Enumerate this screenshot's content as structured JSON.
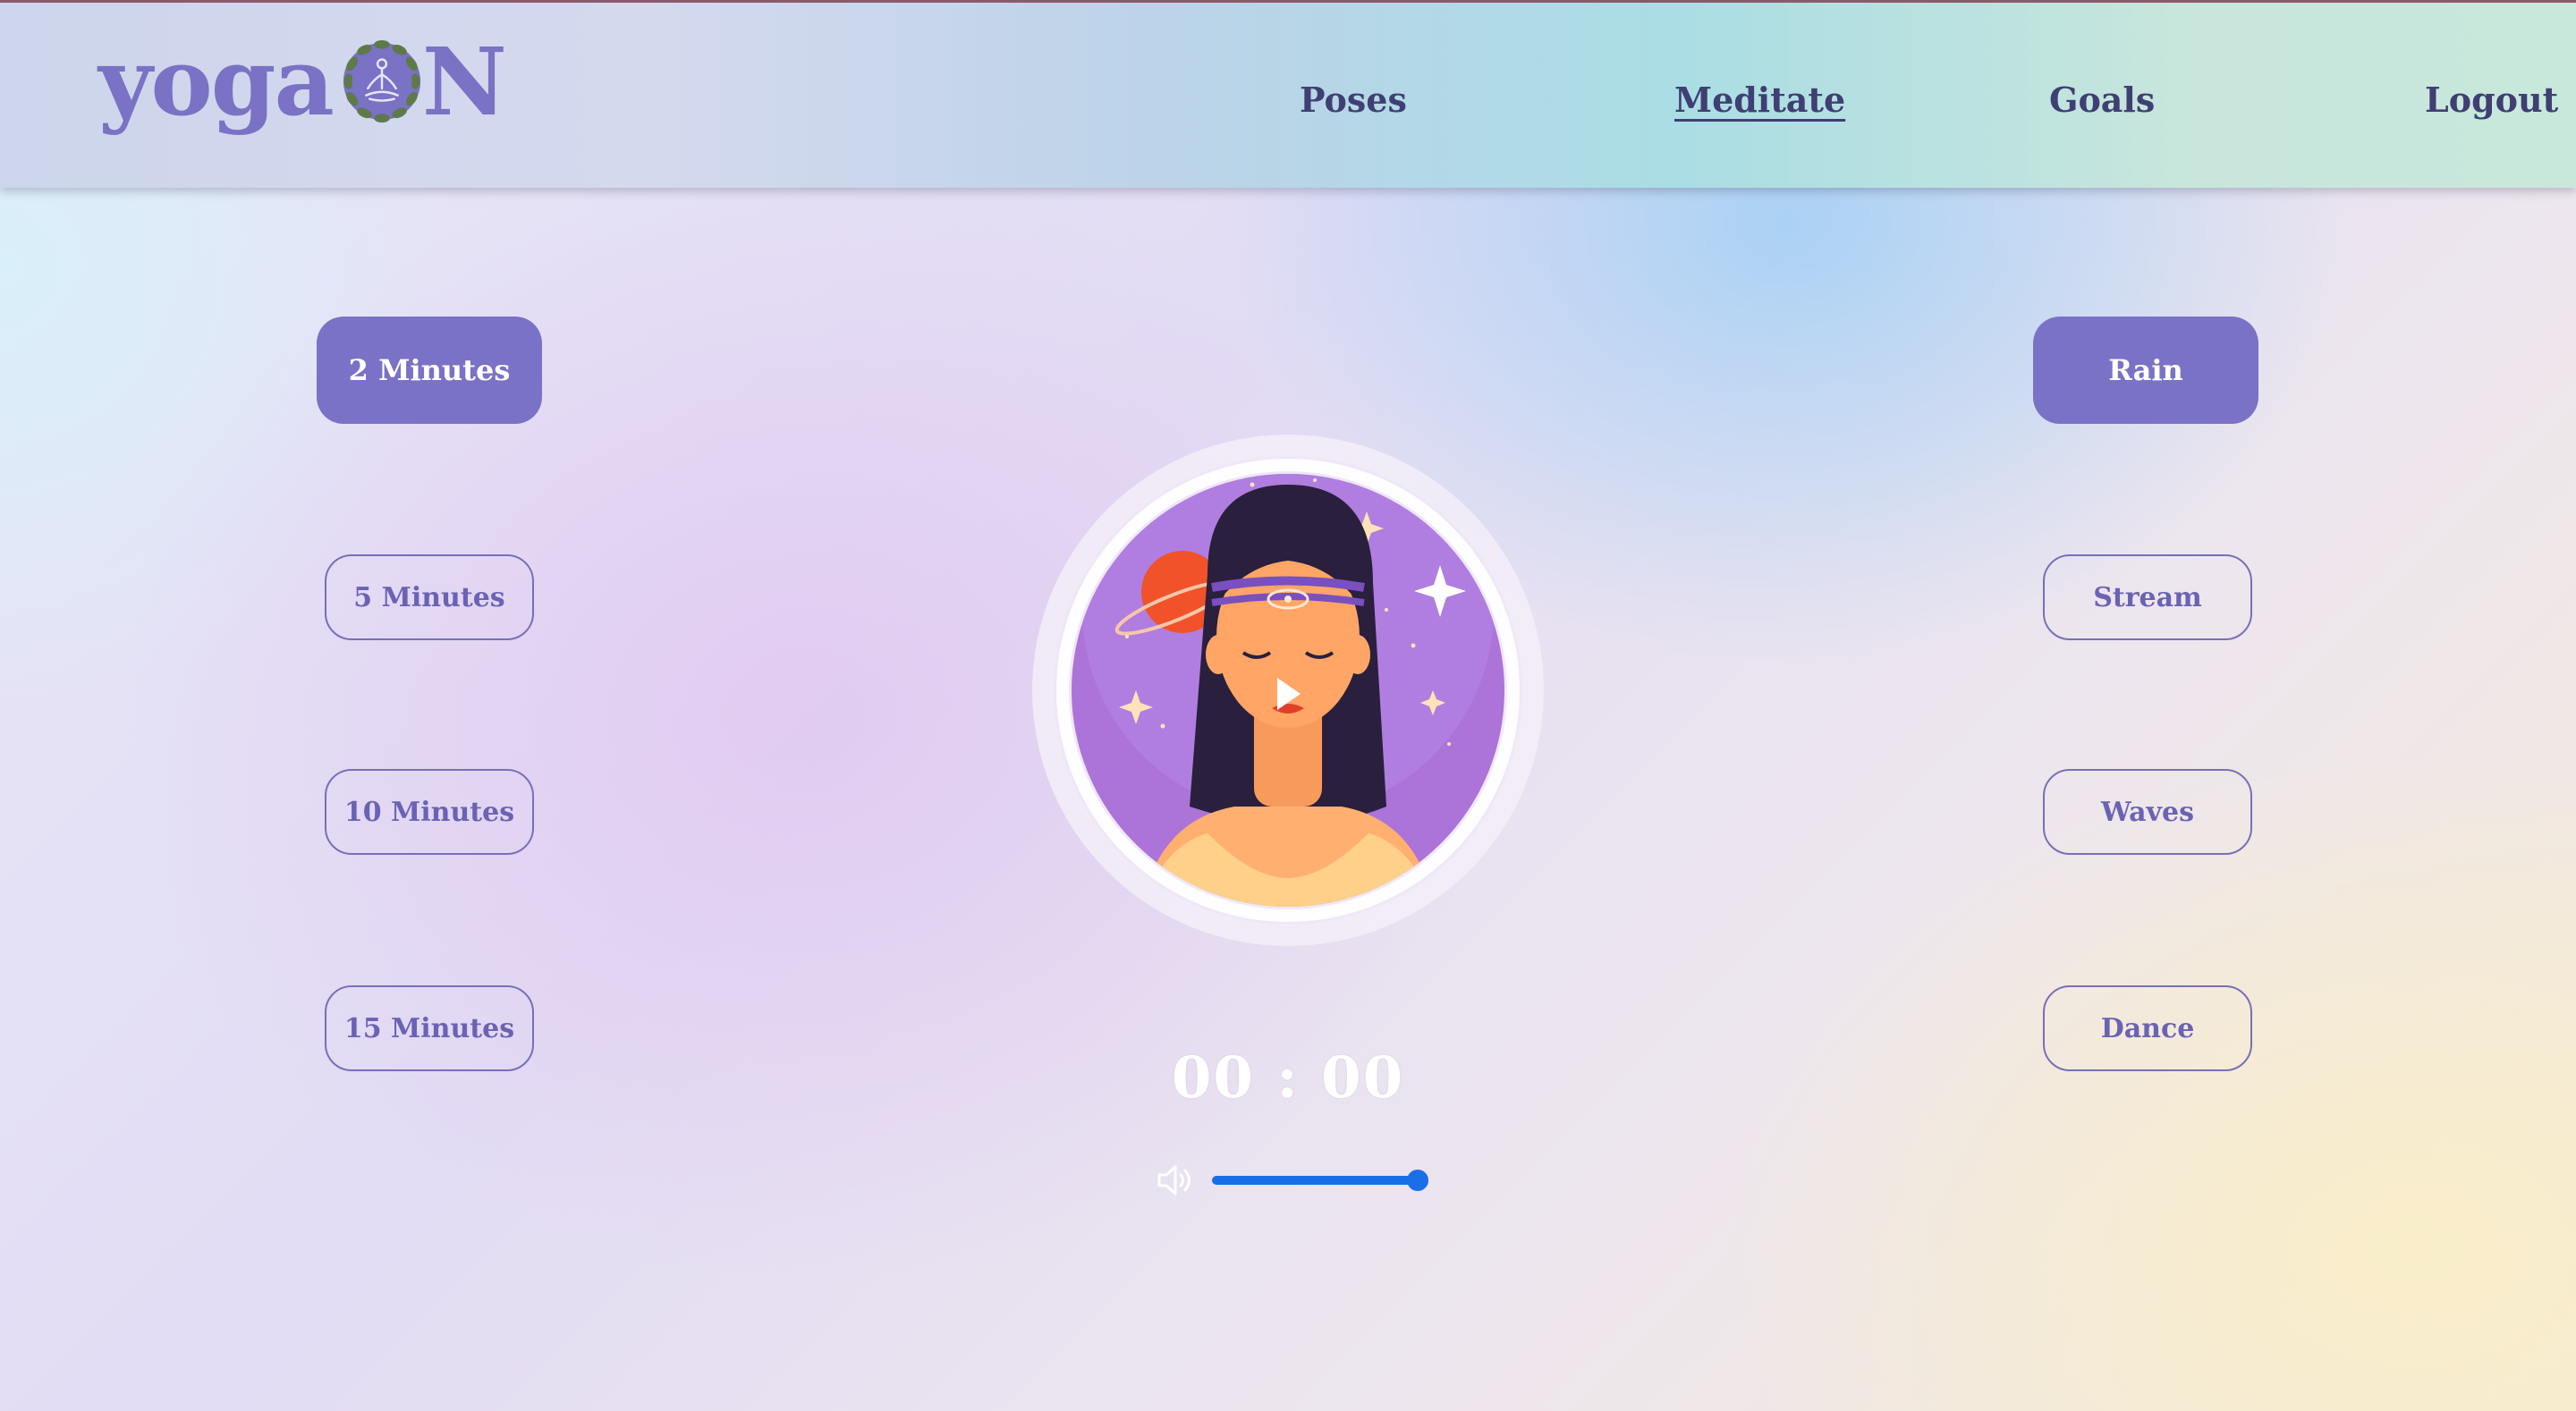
{
  "header": {
    "logo_text_left": "yoga",
    "logo_text_right": "N",
    "nav": [
      {
        "label": "Poses",
        "active": false
      },
      {
        "label": "Meditate",
        "active": true
      },
      {
        "label": "Goals",
        "active": false
      },
      {
        "label": "Logout",
        "active": false
      }
    ]
  },
  "durations": [
    {
      "label": "2 Minutes",
      "selected": true
    },
    {
      "label": "5 Minutes",
      "selected": false
    },
    {
      "label": "10 Minutes",
      "selected": false
    },
    {
      "label": "15 Minutes",
      "selected": false
    }
  ],
  "sounds": [
    {
      "label": "Rain",
      "selected": true
    },
    {
      "label": "Stream",
      "selected": false
    },
    {
      "label": "Waves",
      "selected": false
    },
    {
      "label": "Dance",
      "selected": false
    }
  ],
  "player": {
    "timer": "00 : 00",
    "play_icon": "play-icon",
    "volume_icon": "speaker-volume-icon",
    "volume_level": 1.0
  },
  "colors": {
    "accent": "#7a72c6",
    "nav_text": "#3f3f73",
    "slider": "#1a6fe8",
    "illustration_bg": "#a86fd6"
  }
}
